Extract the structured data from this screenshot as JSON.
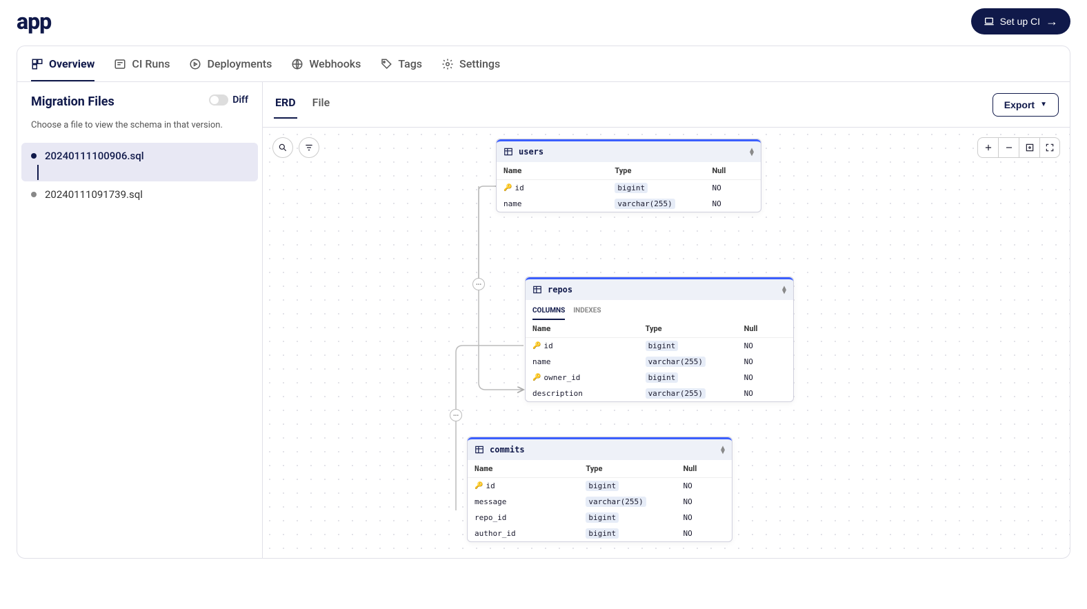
{
  "logo": "app",
  "ci_button": "Set up CI",
  "tabs": [
    "Overview",
    "CI Runs",
    "Deployments",
    "Webhooks",
    "Tags",
    "Settings"
  ],
  "sidebar": {
    "title": "Migration Files",
    "subtitle": "Choose a file to view the schema in that version.",
    "diff_label": "Diff",
    "files": [
      "20240111100906.sql",
      "20240111091739.sql"
    ]
  },
  "view_tabs": [
    "ERD",
    "File"
  ],
  "export_label": "Export",
  "col_headers": {
    "name": "Name",
    "type": "Type",
    "null": "Null"
  },
  "entities": {
    "users": {
      "name": "users",
      "columns": [
        {
          "name": "id",
          "type": "bigint",
          "null": "NO",
          "pk": true
        },
        {
          "name": "name",
          "type": "varchar(255)",
          "null": "NO"
        }
      ]
    },
    "repos": {
      "name": "repos",
      "tabs": [
        "COLUMNS",
        "INDEXES"
      ],
      "columns": [
        {
          "name": "id",
          "type": "bigint",
          "null": "NO",
          "pk": true
        },
        {
          "name": "name",
          "type": "varchar(255)",
          "null": "NO"
        },
        {
          "name": "owner_id",
          "type": "bigint",
          "null": "NO",
          "fk": true
        },
        {
          "name": "description",
          "type": "varchar(255)",
          "null": "NO"
        }
      ]
    },
    "commits": {
      "name": "commits",
      "columns": [
        {
          "name": "id",
          "type": "bigint",
          "null": "NO",
          "pk": true
        },
        {
          "name": "message",
          "type": "varchar(255)",
          "null": "NO"
        },
        {
          "name": "repo_id",
          "type": "bigint",
          "null": "NO"
        },
        {
          "name": "author_id",
          "type": "bigint",
          "null": "NO"
        }
      ]
    }
  }
}
